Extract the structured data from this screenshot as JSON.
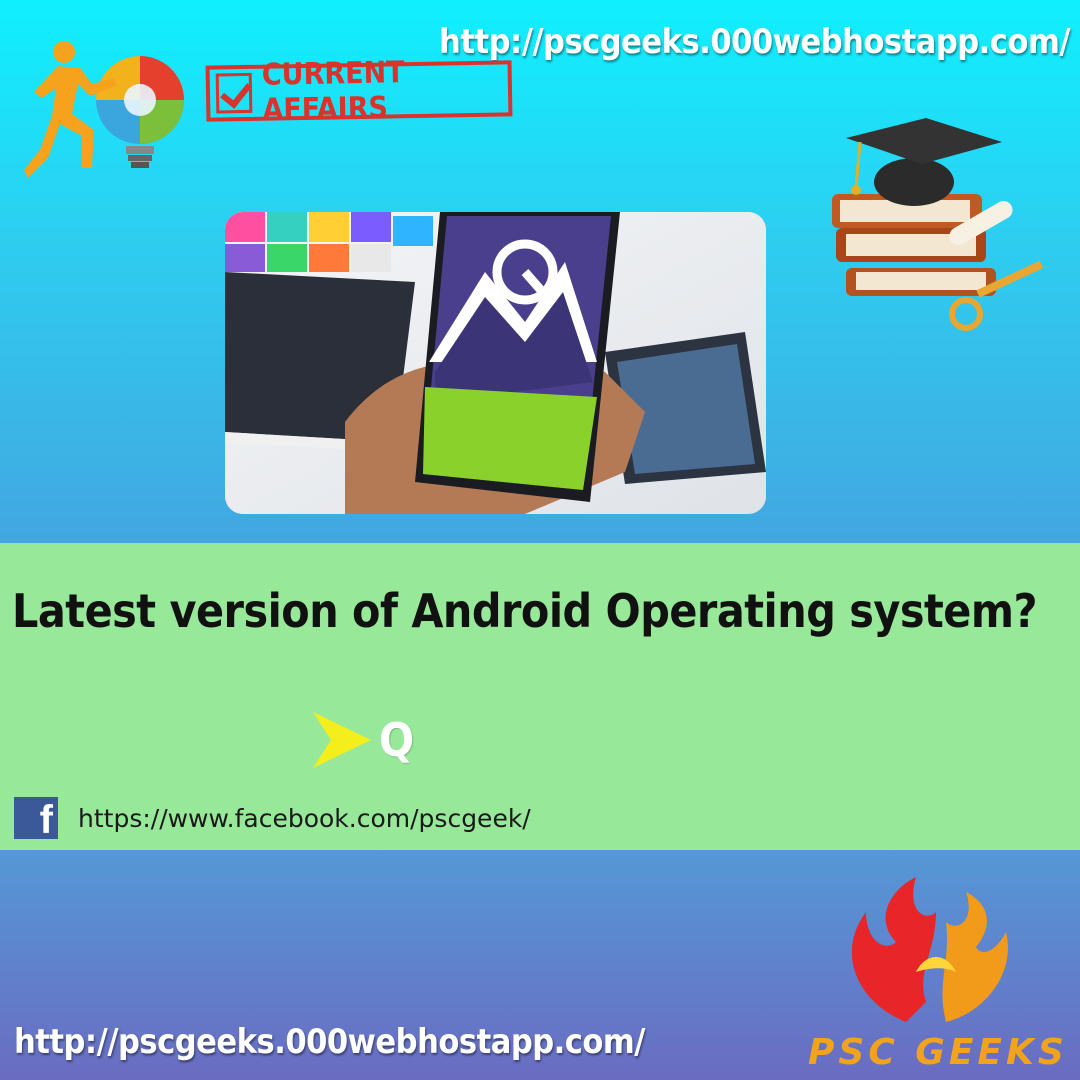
{
  "header": {
    "site_url": "http://pscgeeks.000webhostapp.com/",
    "badge_label": "CURRENT AFFAIRS"
  },
  "question": {
    "text": "Latest version of Android Operating system?",
    "answer": "Q"
  },
  "social": {
    "facebook_icon": "facebook-icon",
    "facebook_glyph": "f",
    "facebook_url": "https://www.facebook.com/pscgeek/"
  },
  "footer": {
    "site_url": "http://pscgeeks.000webhostapp.com/",
    "brand": "PSC GEEKS"
  },
  "colors": {
    "top_gradient_start": "#0ff0ff",
    "middle_band": "#98e89a",
    "bottom_gradient_end": "#6a6cc2",
    "stamp_red": "#d8332c",
    "arrow_yellow": "#f4ef1c",
    "brand_orange": "#f2a31e"
  }
}
